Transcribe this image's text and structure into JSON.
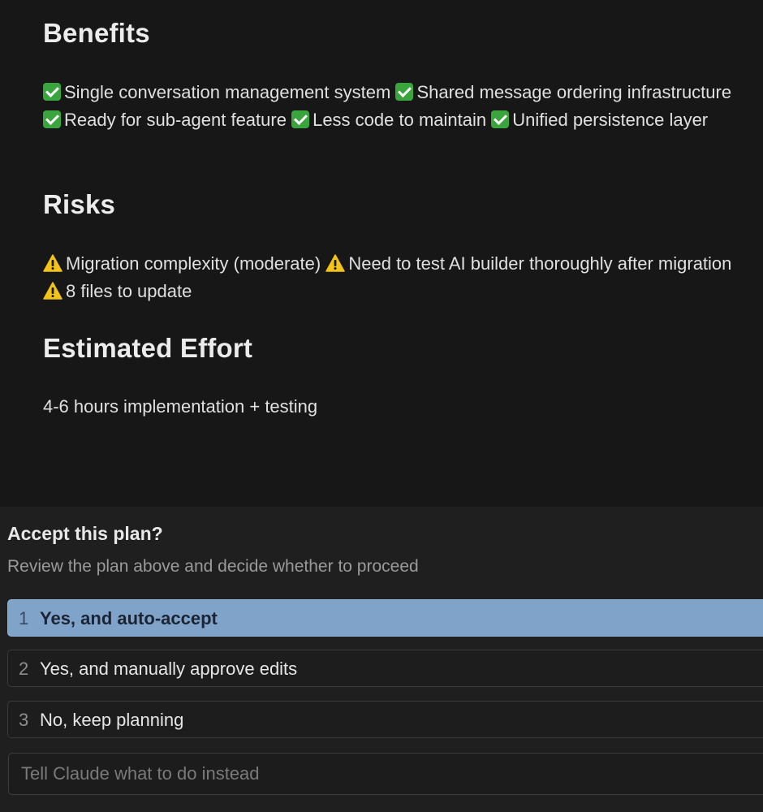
{
  "plan": {
    "benefits": {
      "heading": "Benefits",
      "items": [
        "Single conversation management system",
        "Shared message ordering infrastructure",
        "Ready for sub-agent feature",
        "Less code to maintain",
        "Unified persistence layer"
      ]
    },
    "risks": {
      "heading": "Risks",
      "items": [
        "Migration complexity (moderate)",
        "Need to test AI builder thoroughly after migration",
        "8 files to update"
      ]
    },
    "effort": {
      "heading": "Estimated Effort",
      "text": "4-6 hours implementation + testing"
    }
  },
  "prompt": {
    "title": "Accept this plan?",
    "subtitle": "Review the plan above and decide whether to proceed",
    "options": [
      {
        "number": "1",
        "label": "Yes, and auto-accept",
        "selected": true
      },
      {
        "number": "2",
        "label": "Yes, and manually approve edits",
        "selected": false
      },
      {
        "number": "3",
        "label": "No, keep planning",
        "selected": false
      }
    ],
    "instead_placeholder": "Tell Claude what to do instead",
    "instead_value": ""
  },
  "colors": {
    "page_background": "#171717",
    "panel_background": "#1f1f1f",
    "selected_option": "#7fa3c9",
    "check_green": "#3aa53d",
    "warning_yellow": "#f2c31b"
  },
  "icons": {
    "benefit_item": "check-mark-button-icon",
    "risk_item": "warning-icon"
  }
}
